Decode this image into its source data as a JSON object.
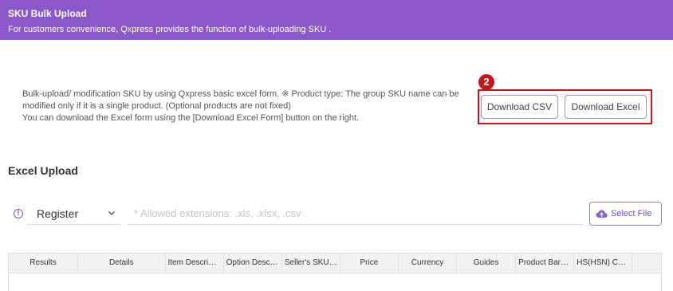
{
  "header": {
    "title": "SKU Bulk Upload",
    "subtitle": "For customers convenience, Qxpress provides the function of bulk-uploading SKU ."
  },
  "description": {
    "line1": "Bulk-upload/ modification SKU by using Qxpress basic excel form. ※ Product type: The group SKU name can be",
    "line2": "modified only if it is a single product. (Optional products are not fixed)",
    "line3": "You can download the Excel form using the [Download Excel Form] button on the right."
  },
  "annotation": {
    "badge_number": "2"
  },
  "buttons": {
    "download_csv": "Download CSV",
    "download_excel": "Download Excel",
    "select_file": "Select File"
  },
  "excel_upload": {
    "title": "Excel Upload",
    "mode_select": {
      "selected": "Register"
    },
    "file_input": {
      "placeholder": "* Allowed extensions: .xls, .xlsx, .csv"
    }
  },
  "table": {
    "columns": [
      "Results",
      "Details",
      "Item Descripti...",
      "Option Descri...",
      "Seller's SKU C...",
      "Price",
      "Currency",
      "Guides",
      "Product Barc...",
      "HS(HSN) Code",
      ""
    ]
  },
  "colors": {
    "header_bg": "#8a58c8",
    "highlight": "#c4161c",
    "accent": "#6f52b5"
  }
}
